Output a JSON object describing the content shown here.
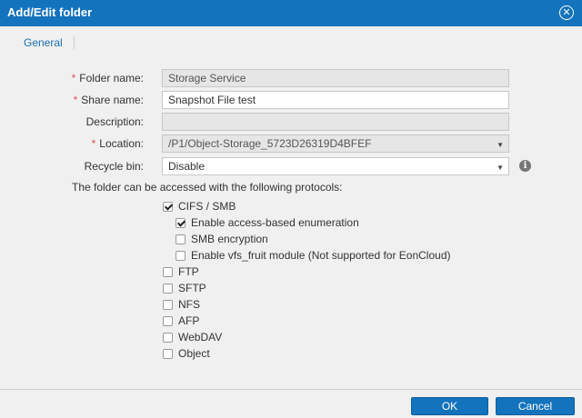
{
  "dialog": {
    "title": "Add/Edit folder",
    "close_icon": "close-icon"
  },
  "tabs": [
    {
      "label": "General",
      "active": true
    }
  ],
  "form": {
    "folder_name": {
      "label": "Folder name:",
      "required_mark": "*",
      "value": "Storage Service",
      "disabled": true
    },
    "share_name": {
      "label": "Share name:",
      "required_mark": "*",
      "value": "Snapshot File test",
      "disabled": false
    },
    "description": {
      "label": "Description:",
      "value": "",
      "disabled": true
    },
    "location": {
      "label": "Location:",
      "required_mark": "*",
      "value": "/P1/Object-Storage_5723D26319D4BFEF",
      "disabled": true
    },
    "recycle_bin": {
      "label": "Recycle bin:",
      "value": "Disable",
      "info_icon": "info-icon"
    }
  },
  "protocols": {
    "title": "The folder can be accessed with the following protocols:",
    "items": [
      {
        "label": "CIFS / SMB",
        "checked": true
      },
      {
        "label": "Enable access-based enumeration",
        "checked": true
      },
      {
        "label": "SMB encryption",
        "checked": false
      },
      {
        "label": "Enable vfs_fruit module (Not supported for EonCloud)",
        "checked": false
      },
      {
        "label": "FTP",
        "checked": false
      },
      {
        "label": "SFTP",
        "checked": false
      },
      {
        "label": "NFS",
        "checked": false
      },
      {
        "label": "AFP",
        "checked": false
      },
      {
        "label": "WebDAV",
        "checked": false
      },
      {
        "label": "Object",
        "checked": false
      }
    ]
  },
  "buttons": {
    "ok": "OK",
    "cancel": "Cancel"
  },
  "colors": {
    "titlebar": "#1473bd",
    "button": "#1473bd",
    "required": "#d9534f",
    "link": "#1a6fb3"
  }
}
